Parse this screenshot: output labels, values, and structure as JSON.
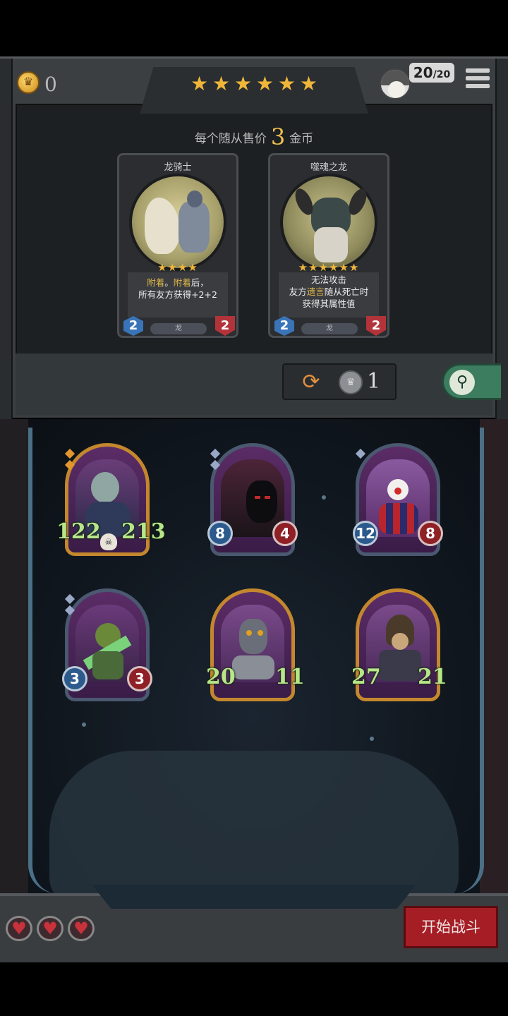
{
  "shop": {
    "coins": "0",
    "stars": "★★★★★★",
    "player_count": "20",
    "player_total": "/20",
    "sell_prefix": "每个随从售价",
    "sell_price": "3",
    "sell_suffix": "金币",
    "cards": [
      {
        "name": "龙骑士",
        "stars": "★★★★",
        "desc_kw1": "附着",
        "desc_mid": "。",
        "desc_kw2": "附着",
        "desc_rest": "后，",
        "desc_line2": "所有友方获得+2+2",
        "tribe": "龙",
        "attack": "2",
        "health": "2"
      },
      {
        "name": "噬魂之龙",
        "stars": "★★★★★★",
        "desc_line1": "无法攻击",
        "desc_l2a": "友方",
        "desc_kw": "遗言",
        "desc_l2b": "随从死亡时",
        "desc_line3": "获得其属性值",
        "tribe": "龙",
        "attack": "2",
        "health": "2"
      }
    ],
    "refresh_cost": "1"
  },
  "board": {
    "units": [
      {
        "attack": "122",
        "health": "213"
      },
      {
        "attack": "8",
        "health": "4"
      },
      {
        "attack": "12",
        "health": "8"
      },
      {
        "attack": "3",
        "health": "3"
      },
      {
        "attack": "20",
        "health": "11"
      },
      {
        "attack": "27",
        "health": "21"
      }
    ],
    "lives": [
      "♥",
      "♥",
      "♥"
    ],
    "start_label": "开始战斗"
  },
  "icons": {
    "coin": "coin-icon",
    "refresh": "refresh-icon",
    "search": "search-icon",
    "menu": "menu-icon",
    "heart": "heart-icon"
  },
  "colors": {
    "star": "#f0b63a",
    "attack": "#3a74b8",
    "health": "#b3333a",
    "start_button": "#a51e25",
    "search_button": "#3d7d5f"
  }
}
